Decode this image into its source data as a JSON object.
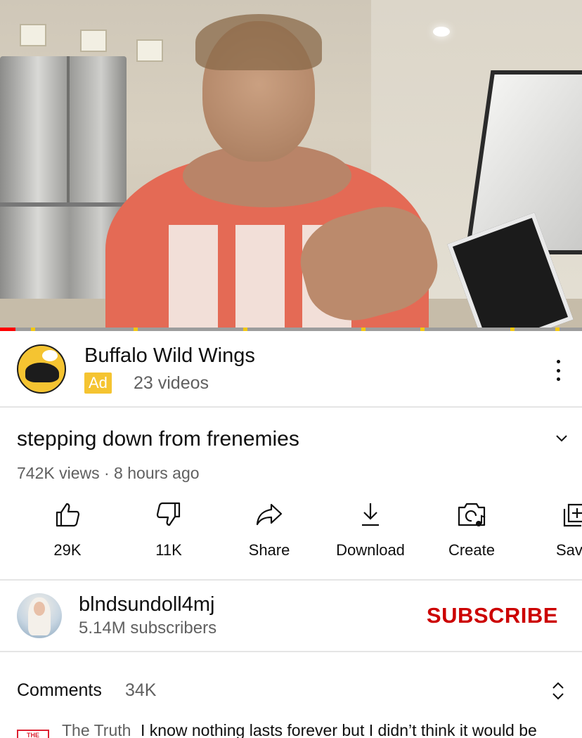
{
  "ad": {
    "advertiser": "Buffalo Wild Wings",
    "badge": "Ad",
    "meta": "23 videos",
    "brand_color": "#f5c431"
  },
  "video": {
    "title": "stepping down from frenemies",
    "stats": "742K views · 8 hours ago",
    "progress_fraction": 0.027,
    "progress_color": "#ff0000",
    "ad_marker_color": "#f2c811"
  },
  "actions": [
    {
      "icon": "thumbs-up-icon",
      "label": "29K"
    },
    {
      "icon": "thumbs-down-icon",
      "label": "11K"
    },
    {
      "icon": "share-icon",
      "label": "Share"
    },
    {
      "icon": "download-icon",
      "label": "Download"
    },
    {
      "icon": "create-icon",
      "label": "Create"
    },
    {
      "icon": "save-icon",
      "label": "Sav"
    }
  ],
  "channel": {
    "name": "blndsundoll4mj",
    "subscribers": "5.14M subscribers",
    "subscribe_label": "SUBSCRIBE",
    "subscribe_color": "#cc0000"
  },
  "comments": {
    "heading": "Comments",
    "count": "34K",
    "preview_author": "The Truth",
    "preview_text": "I know nothing lasts forever but I didn’t think it would be",
    "preview_avatar_text": "THE TRUTH"
  }
}
